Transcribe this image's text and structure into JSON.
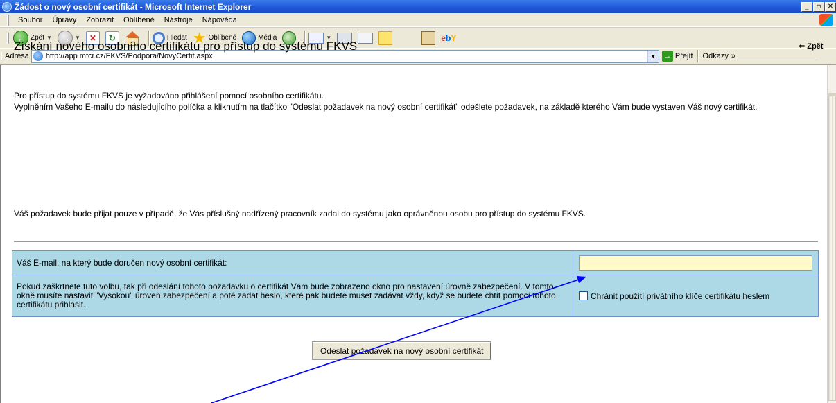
{
  "window": {
    "title": "Žádost o nový osobní certifikát - Microsoft Internet Explorer",
    "buttons": [
      "_",
      "▫",
      "✕"
    ]
  },
  "menu": {
    "items": [
      "Soubor",
      "Úpravy",
      "Zobrazit",
      "Oblíbené",
      "Nástroje",
      "Nápověda"
    ]
  },
  "toolbar": {
    "back_label": "Zpět",
    "search_label": "Hledat",
    "favorites_label": "Oblíbené",
    "media_label": "Média"
  },
  "address": {
    "label": "Adresa",
    "url": "http://app.mfcr.cz/FKVS/Podpora/NovyCertif.aspx",
    "go_label": "Přejít",
    "links_label": "Odkazy",
    "links_chevron": "»"
  },
  "page": {
    "title": "Získání nového osobního certifikátu pro přístup do systému FKVS",
    "back_link": "Zpět",
    "back_arrow": "⇐",
    "paragraph1": "Pro přístup do systému FKVS je vyžadováno přihlášení pomocí osobního certifikátu.",
    "paragraph2": "Vyplněním Vašeho E-mailu do následujícího políčka a kliknutím na tlačítko \"Odeslat požadavek na nový osobní certifikát\" odešlete požadavek, na základě kterého Vám bude vystaven Váš nový certifikát.",
    "paragraph3": "Váš požadavek bude přijat pouze v případě, že Vás příslušný nadřízený pracovník zadal do systému jako oprávněnou osobu pro přístup do systému FKVS."
  },
  "form": {
    "email_label": "Váš E-mail, na který bude doručen nový osobní certifikát:",
    "email_value": "",
    "protect_description": "Pokud zaškrtnete tuto volbu, tak při odeslání tohoto požadavku o certifikát Vám bude zobrazeno okno pro nastavení úrovně zabezpečení. V tomto okně musíte nastavit \"Vysokou\" úroveň zabezpečení a poté zadat heslo, které pak budete muset zadávat vždy, když se budete chtít pomocí tohoto certifikátu přihlásit.",
    "protect_checkbox_label": "Chránit použití privátního klíče certifikátu heslem",
    "protect_checked": false,
    "submit_label": "Odeslat požadavek na nový osobní certifikát"
  },
  "colors": {
    "form_background": "#add8e6",
    "email_field_background": "#fffac8",
    "annotation_arrow": "#0000ff"
  }
}
